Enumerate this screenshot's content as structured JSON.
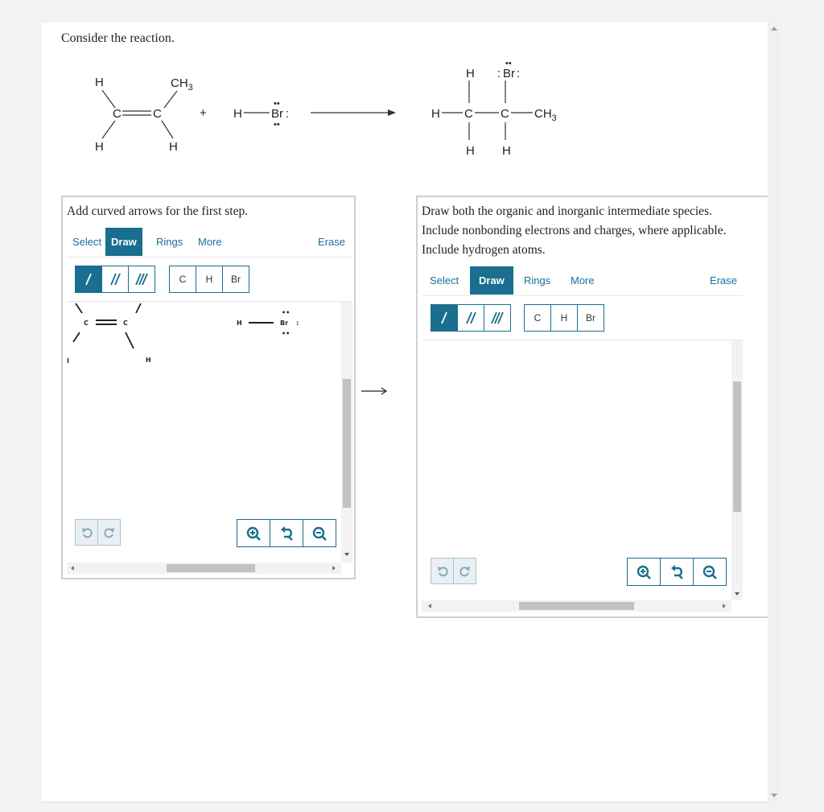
{
  "question": "Consider the reaction.",
  "reaction": {
    "reactant1": {
      "top_left": "H",
      "top_right": "CH3",
      "left_c": "C",
      "right_c": "C",
      "bottom_left": "H",
      "bottom_right": "H"
    },
    "plus": "+",
    "reactant2": {
      "h": "H",
      "br": "Br"
    },
    "product": {
      "h_left": "H",
      "c1": "C",
      "c2": "C",
      "ch3": "CH3",
      "h_top": "H",
      "br_top": "Br",
      "h_bottom1": "H",
      "h_bottom2": "H"
    }
  },
  "left_panel": {
    "instruction": "Add curved arrows for the first step.",
    "tabs": [
      "Select",
      "Draw",
      "Rings",
      "More"
    ],
    "active_tab": "Draw",
    "erase": "Erase",
    "atoms": [
      "C",
      "H",
      "Br"
    ],
    "canvas": {
      "c1": "C",
      "c2": "C",
      "h_bottom": "H",
      "h": "H",
      "br": "Br",
      "edge_fragment": "I"
    }
  },
  "right_panel": {
    "instruction": "Draw both the organic and inorganic intermediate species. Include nonbonding electrons and charges, where applicable. Include hydrogen atoms.",
    "tabs": [
      "Select",
      "Draw",
      "Rings",
      "More"
    ],
    "active_tab": "Draw",
    "erase": "Erase",
    "atoms": [
      "C",
      "H",
      "Br"
    ]
  },
  "colors": {
    "accent": "#1a6e8f",
    "link": "#1a6fa0",
    "panel_border": "#cfcfcf"
  },
  "icons": [
    "single-bond-icon",
    "double-bond-icon",
    "triple-bond-icon",
    "undo-icon",
    "redo-icon",
    "zoom-in-icon",
    "zoom-reset-icon",
    "zoom-out-icon",
    "arrow-right-icon"
  ]
}
